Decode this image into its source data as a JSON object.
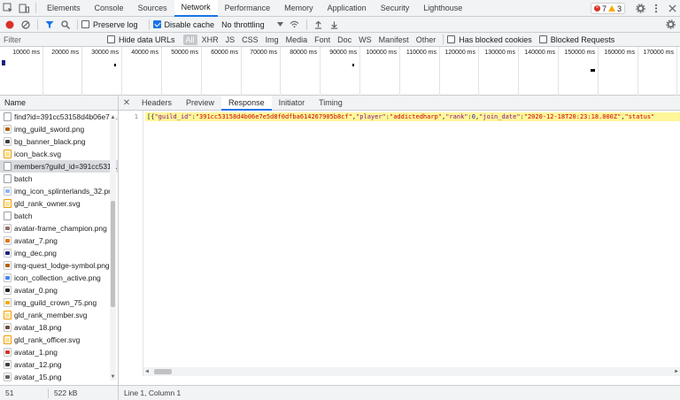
{
  "topbar": {
    "tabs": [
      "Elements",
      "Console",
      "Sources",
      "Network",
      "Performance",
      "Memory",
      "Application",
      "Security",
      "Lighthouse"
    ],
    "active_tab": "Network",
    "errors": "7",
    "warnings": "3"
  },
  "toolbar": {
    "preserve_log_label": "Preserve log",
    "disable_cache_label": "Disable cache",
    "throttling_label": "No throttling"
  },
  "filterbar": {
    "filter_placeholder": "Filter",
    "hide_data_urls_label": "Hide data URLs",
    "types": [
      "All",
      "XHR",
      "JS",
      "CSS",
      "Img",
      "Media",
      "Font",
      "Doc",
      "WS",
      "Manifest",
      "Other"
    ],
    "active_type": "All",
    "has_blocked_cookies_label": "Has blocked cookies",
    "blocked_requests_label": "Blocked Requests"
  },
  "overview": {
    "ticks": [
      "10000 ms",
      "20000 ms",
      "30000 ms",
      "40000 ms",
      "50000 ms",
      "60000 ms",
      "70000 ms",
      "80000 ms",
      "90000 ms",
      "100000 ms",
      "110000 ms",
      "120000 ms",
      "130000 ms",
      "140000 ms",
      "150000 ms",
      "160000 ms",
      "170000 ms"
    ]
  },
  "requests": {
    "header": "Name",
    "items": [
      {
        "name": "find?id=391cc53158d4b06e7e...",
        "kind": "doc"
      },
      {
        "name": "img_guild_sword.png",
        "kind": "img",
        "color": "#b06000"
      },
      {
        "name": "bg_banner_black.png",
        "kind": "img",
        "color": "#3c4043"
      },
      {
        "name": "icon_back.svg",
        "kind": "svg"
      },
      {
        "name": "members?guild_id=391cc531...",
        "kind": "doc"
      },
      {
        "name": "batch",
        "kind": "doc"
      },
      {
        "name": "img_icon_splinterlands_32.png",
        "kind": "img",
        "color": "#8ab4f8"
      },
      {
        "name": "gld_rank_owner.svg",
        "kind": "svg"
      },
      {
        "name": "batch",
        "kind": "doc"
      },
      {
        "name": "avatar-frame_champion.png",
        "kind": "img",
        "color": "#8d6e63"
      },
      {
        "name": "avatar_7.png",
        "kind": "img",
        "color": "#e37400"
      },
      {
        "name": "img_dec.png",
        "kind": "img",
        "color": "#1a237e"
      },
      {
        "name": "img-quest_lodge-symbol.png",
        "kind": "img",
        "color": "#b06000"
      },
      {
        "name": "icon_collection_active.png",
        "kind": "img",
        "color": "#4285f4"
      },
      {
        "name": "avatar_0.png",
        "kind": "img",
        "color": "#202124"
      },
      {
        "name": "img_guild_crown_75.png",
        "kind": "img",
        "color": "#f9ab00"
      },
      {
        "name": "gld_rank_member.svg",
        "kind": "svg"
      },
      {
        "name": "avatar_18.png",
        "kind": "img",
        "color": "#6d4c41"
      },
      {
        "name": "gld_rank_officer.svg",
        "kind": "svg"
      },
      {
        "name": "avatar_1.png",
        "kind": "img",
        "color": "#d93025"
      },
      {
        "name": "avatar_12.png",
        "kind": "img",
        "color": "#3c4043"
      },
      {
        "name": "avatar_15.png",
        "kind": "img",
        "color": "#5f6368"
      }
    ],
    "selected_index": 4
  },
  "detail": {
    "tabs": [
      "Headers",
      "Preview",
      "Response",
      "Initiator",
      "Timing"
    ],
    "active_tab": "Response",
    "line_number": "1",
    "response_line": "[{\"guild_id\":\"391cc53158d4b06e7e5d8f0dfba614267905b8cf\",\"player\":\"addictedharp\",\"rank\":0,\"join_date\":\"2020-12-18T20:23:18.000Z\",\"status\""
  },
  "status": {
    "requests": "51 requests",
    "transferred": "522 kB transferred",
    "cursor": "Line 1, Column 1"
  }
}
